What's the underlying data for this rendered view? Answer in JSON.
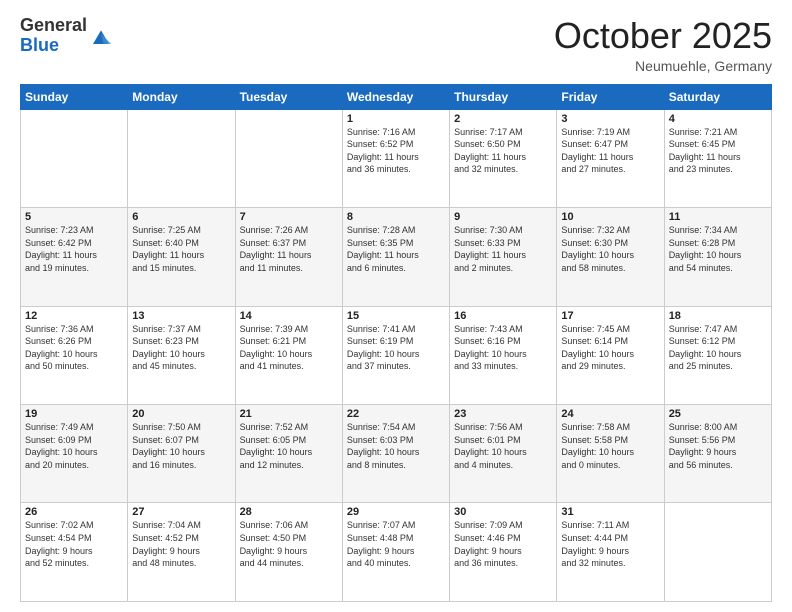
{
  "logo": {
    "general": "General",
    "blue": "Blue"
  },
  "title": "October 2025",
  "location": "Neumuehle, Germany",
  "days_header": [
    "Sunday",
    "Monday",
    "Tuesday",
    "Wednesday",
    "Thursday",
    "Friday",
    "Saturday"
  ],
  "weeks": [
    [
      {
        "num": "",
        "info": ""
      },
      {
        "num": "",
        "info": ""
      },
      {
        "num": "",
        "info": ""
      },
      {
        "num": "1",
        "info": "Sunrise: 7:16 AM\nSunset: 6:52 PM\nDaylight: 11 hours\nand 36 minutes."
      },
      {
        "num": "2",
        "info": "Sunrise: 7:17 AM\nSunset: 6:50 PM\nDaylight: 11 hours\nand 32 minutes."
      },
      {
        "num": "3",
        "info": "Sunrise: 7:19 AM\nSunset: 6:47 PM\nDaylight: 11 hours\nand 27 minutes."
      },
      {
        "num": "4",
        "info": "Sunrise: 7:21 AM\nSunset: 6:45 PM\nDaylight: 11 hours\nand 23 minutes."
      }
    ],
    [
      {
        "num": "5",
        "info": "Sunrise: 7:23 AM\nSunset: 6:42 PM\nDaylight: 11 hours\nand 19 minutes."
      },
      {
        "num": "6",
        "info": "Sunrise: 7:25 AM\nSunset: 6:40 PM\nDaylight: 11 hours\nand 15 minutes."
      },
      {
        "num": "7",
        "info": "Sunrise: 7:26 AM\nSunset: 6:37 PM\nDaylight: 11 hours\nand 11 minutes."
      },
      {
        "num": "8",
        "info": "Sunrise: 7:28 AM\nSunset: 6:35 PM\nDaylight: 11 hours\nand 6 minutes."
      },
      {
        "num": "9",
        "info": "Sunrise: 7:30 AM\nSunset: 6:33 PM\nDaylight: 11 hours\nand 2 minutes."
      },
      {
        "num": "10",
        "info": "Sunrise: 7:32 AM\nSunset: 6:30 PM\nDaylight: 10 hours\nand 58 minutes."
      },
      {
        "num": "11",
        "info": "Sunrise: 7:34 AM\nSunset: 6:28 PM\nDaylight: 10 hours\nand 54 minutes."
      }
    ],
    [
      {
        "num": "12",
        "info": "Sunrise: 7:36 AM\nSunset: 6:26 PM\nDaylight: 10 hours\nand 50 minutes."
      },
      {
        "num": "13",
        "info": "Sunrise: 7:37 AM\nSunset: 6:23 PM\nDaylight: 10 hours\nand 45 minutes."
      },
      {
        "num": "14",
        "info": "Sunrise: 7:39 AM\nSunset: 6:21 PM\nDaylight: 10 hours\nand 41 minutes."
      },
      {
        "num": "15",
        "info": "Sunrise: 7:41 AM\nSunset: 6:19 PM\nDaylight: 10 hours\nand 37 minutes."
      },
      {
        "num": "16",
        "info": "Sunrise: 7:43 AM\nSunset: 6:16 PM\nDaylight: 10 hours\nand 33 minutes."
      },
      {
        "num": "17",
        "info": "Sunrise: 7:45 AM\nSunset: 6:14 PM\nDaylight: 10 hours\nand 29 minutes."
      },
      {
        "num": "18",
        "info": "Sunrise: 7:47 AM\nSunset: 6:12 PM\nDaylight: 10 hours\nand 25 minutes."
      }
    ],
    [
      {
        "num": "19",
        "info": "Sunrise: 7:49 AM\nSunset: 6:09 PM\nDaylight: 10 hours\nand 20 minutes."
      },
      {
        "num": "20",
        "info": "Sunrise: 7:50 AM\nSunset: 6:07 PM\nDaylight: 10 hours\nand 16 minutes."
      },
      {
        "num": "21",
        "info": "Sunrise: 7:52 AM\nSunset: 6:05 PM\nDaylight: 10 hours\nand 12 minutes."
      },
      {
        "num": "22",
        "info": "Sunrise: 7:54 AM\nSunset: 6:03 PM\nDaylight: 10 hours\nand 8 minutes."
      },
      {
        "num": "23",
        "info": "Sunrise: 7:56 AM\nSunset: 6:01 PM\nDaylight: 10 hours\nand 4 minutes."
      },
      {
        "num": "24",
        "info": "Sunrise: 7:58 AM\nSunset: 5:58 PM\nDaylight: 10 hours\nand 0 minutes."
      },
      {
        "num": "25",
        "info": "Sunrise: 8:00 AM\nSunset: 5:56 PM\nDaylight: 9 hours\nand 56 minutes."
      }
    ],
    [
      {
        "num": "26",
        "info": "Sunrise: 7:02 AM\nSunset: 4:54 PM\nDaylight: 9 hours\nand 52 minutes."
      },
      {
        "num": "27",
        "info": "Sunrise: 7:04 AM\nSunset: 4:52 PM\nDaylight: 9 hours\nand 48 minutes."
      },
      {
        "num": "28",
        "info": "Sunrise: 7:06 AM\nSunset: 4:50 PM\nDaylight: 9 hours\nand 44 minutes."
      },
      {
        "num": "29",
        "info": "Sunrise: 7:07 AM\nSunset: 4:48 PM\nDaylight: 9 hours\nand 40 minutes."
      },
      {
        "num": "30",
        "info": "Sunrise: 7:09 AM\nSunset: 4:46 PM\nDaylight: 9 hours\nand 36 minutes."
      },
      {
        "num": "31",
        "info": "Sunrise: 7:11 AM\nSunset: 4:44 PM\nDaylight: 9 hours\nand 32 minutes."
      },
      {
        "num": "",
        "info": ""
      }
    ]
  ]
}
